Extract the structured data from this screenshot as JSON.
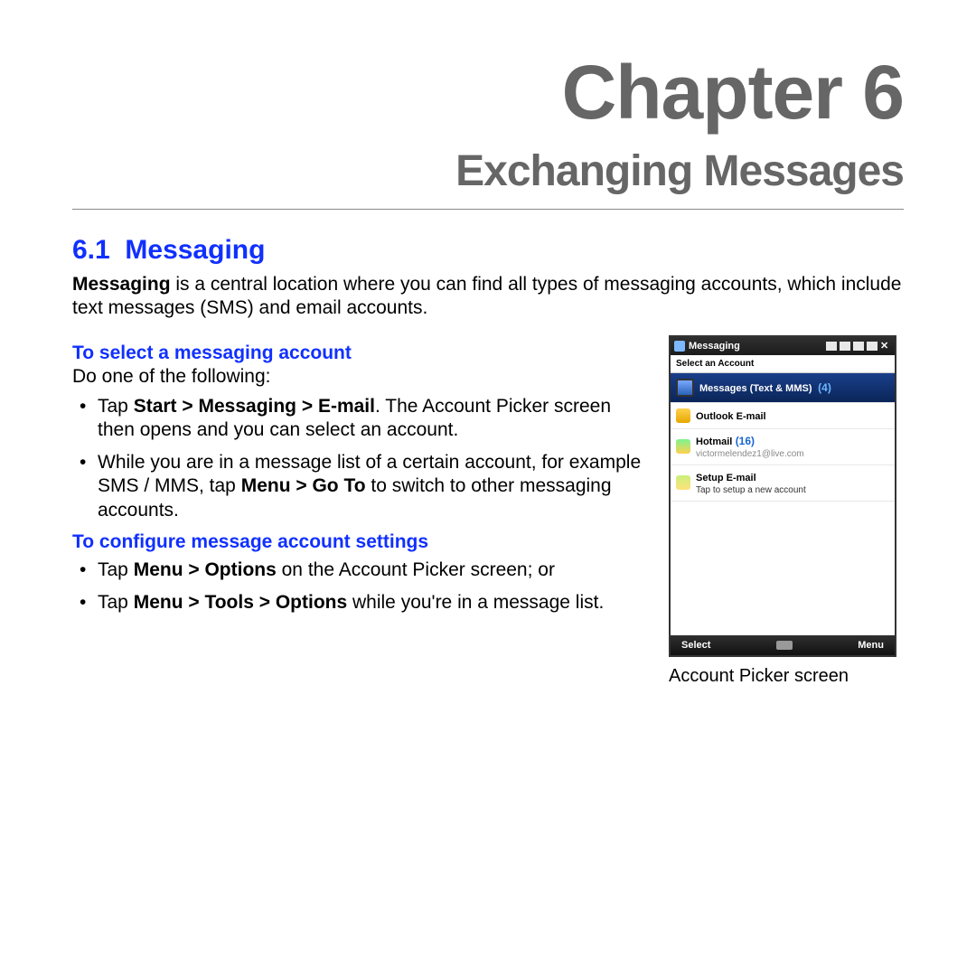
{
  "chapter": {
    "title": "Chapter 6",
    "subtitle": "Exchanging Messages"
  },
  "section": {
    "num": "6.1",
    "title": "Messaging"
  },
  "intro_parts": {
    "bold": "Messaging",
    "rest": " is a central location where you can find all types of messaging accounts, which include text messages (SMS) and email accounts."
  },
  "select_heading": "To select a messaging account",
  "do_one": "Do one of the following:",
  "bullets_select": [
    {
      "pre": "Tap ",
      "bold": "Start > Messaging > E-mail",
      "post": ". The Account Picker screen then opens and you can select an account."
    },
    {
      "pre": "While you are in a message list of a certain account, for example SMS / MMS, tap ",
      "bold": "Menu > Go To",
      "post": " to switch to other messaging accounts."
    }
  ],
  "config_heading": "To configure message account settings",
  "bullets_config": [
    {
      "pre": "Tap ",
      "bold": "Menu > Options",
      "post": " on the Account Picker screen; or"
    },
    {
      "pre": "Tap ",
      "bold": "Menu > Tools > Options",
      "post": " while you're in a message list."
    }
  ],
  "phone": {
    "title": "Messaging",
    "select_an_account": "Select an Account",
    "rows": [
      {
        "label": "Messages (Text & MMS)",
        "count": "(4)"
      },
      {
        "label": "Outlook E-mail"
      },
      {
        "label": "Hotmail",
        "count": "(16)",
        "sub": "victormelendez1@live.com"
      },
      {
        "label": "Setup E-mail",
        "sub": "Tap to setup a new account"
      }
    ],
    "softkeys": {
      "left": "Select",
      "right": "Menu"
    }
  },
  "caption": "Account Picker screen"
}
